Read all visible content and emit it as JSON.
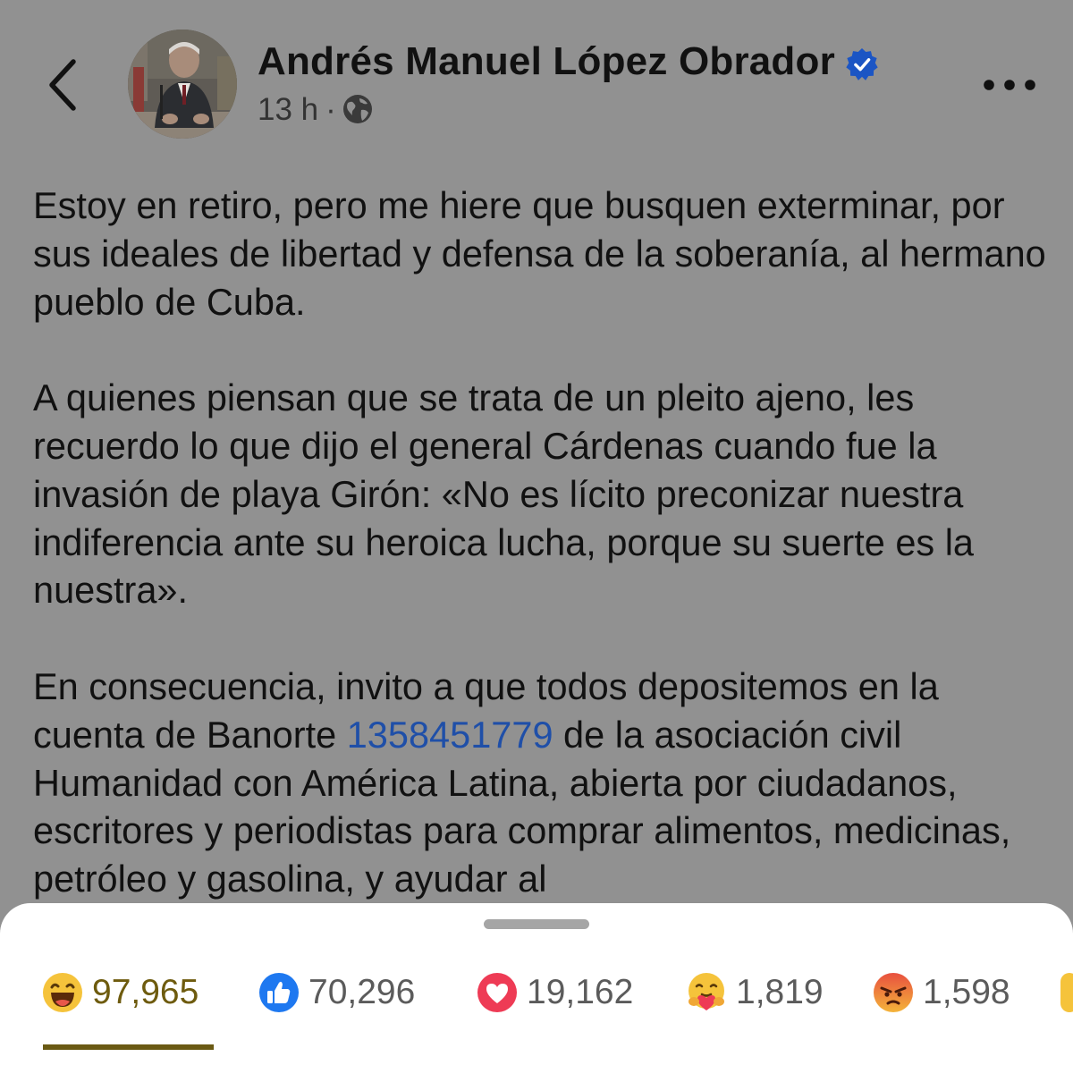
{
  "header": {
    "author_name": "Andrés Manuel López Obrador",
    "timestamp": "13 h",
    "separator": "·",
    "audience_icon": "globe-icon",
    "back_icon": "chevron-left-icon",
    "more_icon": "more-horizontal-icon",
    "verified": true
  },
  "post": {
    "paragraphs": [
      "Estoy en retiro, pero me hiere que busquen exterminar, por sus ideales de libertad y defensa de la soberanía, al hermano pueblo de Cuba.",
      "A quienes piensan que se trata de un pleito ajeno, les recuerdo lo que dijo el general Cárdenas cuando fue la invasión de playa Girón: «No es lícito preconizar nuestra indiferencia ante su heroica lucha, porque su suerte es la nuestra»."
    ],
    "p3_before": "En consecuencia, invito a que todos depositemos en la cuenta de Banorte ",
    "p3_account": "1358451779",
    "p3_after": " de la asociación civil Humanidad con América Latina, abierta por ciudadanos, escritores y periodistas para comprar alimentos, medicinas, petróleo y gasolina, y ayudar al"
  },
  "reactions": [
    {
      "type": "haha",
      "icon": "haha-icon",
      "count": "97,965",
      "active": true
    },
    {
      "type": "like",
      "icon": "like-icon",
      "count": "70,296",
      "active": false
    },
    {
      "type": "love",
      "icon": "love-icon",
      "count": "19,162",
      "active": false
    },
    {
      "type": "care",
      "icon": "care-icon",
      "count": "1,819",
      "active": false
    },
    {
      "type": "angry",
      "icon": "angry-icon",
      "count": "1,598",
      "active": false
    }
  ],
  "colors": {
    "page_background": "#919191",
    "link": "#1f4fa8",
    "verified_badge": "#1b55c4",
    "active_tab_underline": "#6a5a13"
  }
}
